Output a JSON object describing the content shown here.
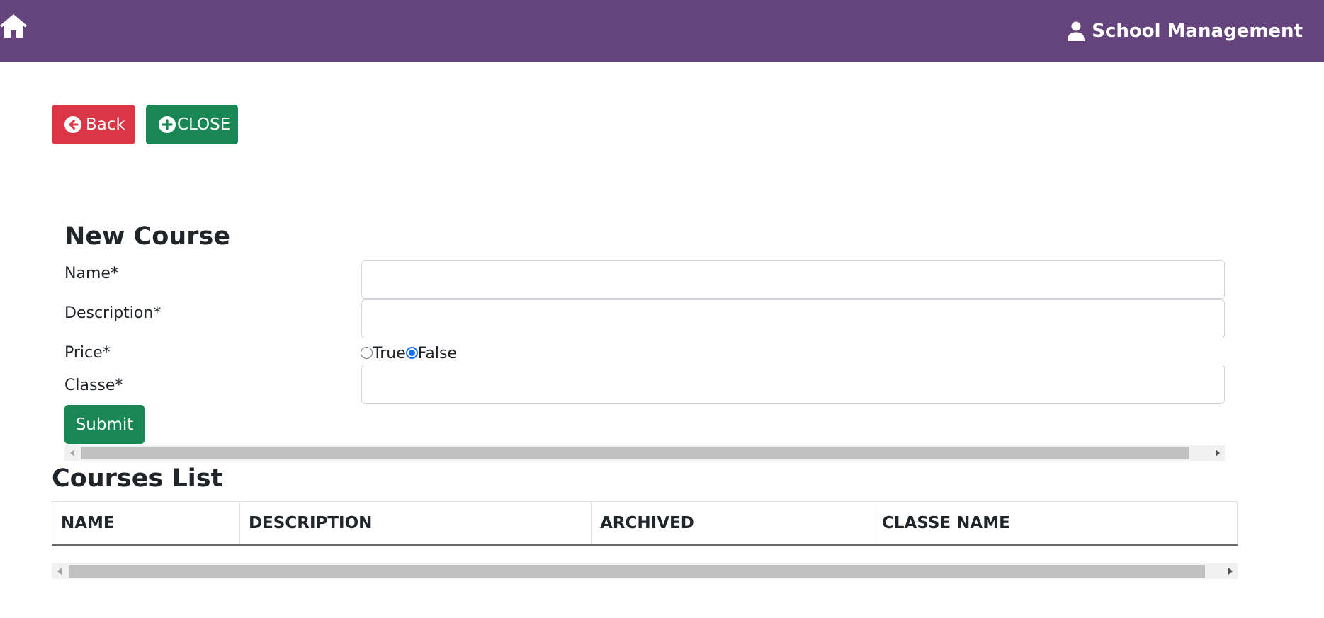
{
  "header": {
    "home_icon": "home-icon",
    "user_icon": "user-icon",
    "title": "School Management",
    "bg_color": "#65447d"
  },
  "actions": {
    "back_label": "Back",
    "close_label": "CLOSE"
  },
  "form": {
    "title": "New Course",
    "fields": {
      "name_label": "Name*",
      "name_value": "",
      "description_label": "Description*",
      "description_value": "",
      "price_label": "Price*",
      "price_options": [
        "True",
        "False"
      ],
      "price_selected": "False",
      "classe_label": "Classe*",
      "classe_value": ""
    },
    "submit_label": "Submit"
  },
  "list": {
    "title": "Courses List",
    "columns": [
      "NAME",
      "DESCRIPTION",
      "ARCHIVED",
      "CLASSE NAME"
    ],
    "rows": []
  },
  "colors": {
    "danger": "#dc3545",
    "success": "#198754",
    "radio_checked": "#0d6efd"
  }
}
